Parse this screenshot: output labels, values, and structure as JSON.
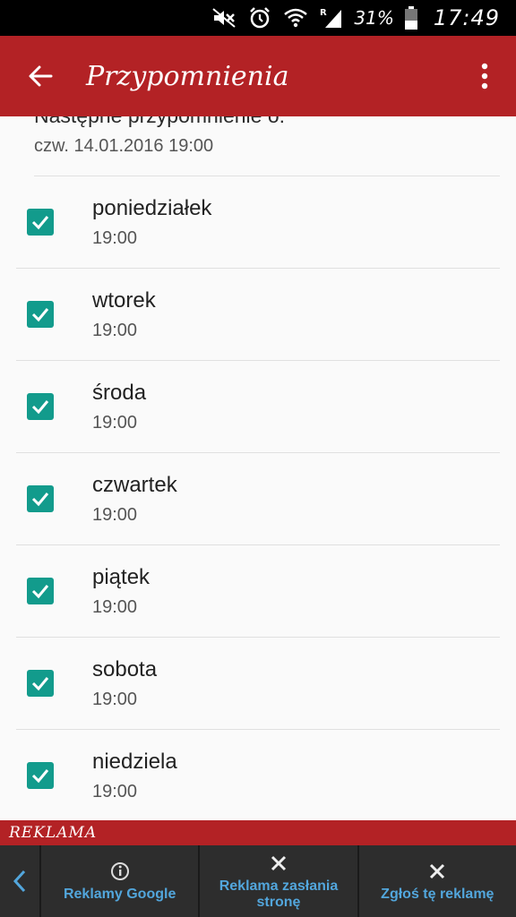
{
  "statusbar": {
    "battery_pct": "31%",
    "time": "17:49",
    "icons": [
      "mute-icon",
      "alarm-icon",
      "wifi-icon",
      "signal-icon",
      "battery-icon"
    ]
  },
  "appbar": {
    "title": "Przypomnienia",
    "icons": [
      "back-arrow-icon",
      "more-vert-icon"
    ]
  },
  "next_reminder": {
    "label": "Następne przypomnienie o:",
    "value": "czw. 14.01.2016 19:00"
  },
  "days": [
    {
      "name": "poniedziałek",
      "time": "19:00",
      "checked": true
    },
    {
      "name": "wtorek",
      "time": "19:00",
      "checked": true
    },
    {
      "name": "środa",
      "time": "19:00",
      "checked": true
    },
    {
      "name": "czwartek",
      "time": "19:00",
      "checked": true
    },
    {
      "name": "piątek",
      "time": "19:00",
      "checked": true
    },
    {
      "name": "sobota",
      "time": "19:00",
      "checked": true
    },
    {
      "name": "niedziela",
      "time": "19:00",
      "checked": true
    }
  ],
  "ad": {
    "label": "REKLAMA",
    "buttons": [
      {
        "label": "Reklamy Google",
        "icon": "info-icon"
      },
      {
        "label": "Reklama zasłania stronę",
        "icon": "close-icon"
      },
      {
        "label": "Zgłoś tę reklamę",
        "icon": "close-icon"
      }
    ]
  },
  "colors": {
    "primary": "#b32225",
    "accent": "#129b8c",
    "ad_link": "#52a6dc"
  }
}
